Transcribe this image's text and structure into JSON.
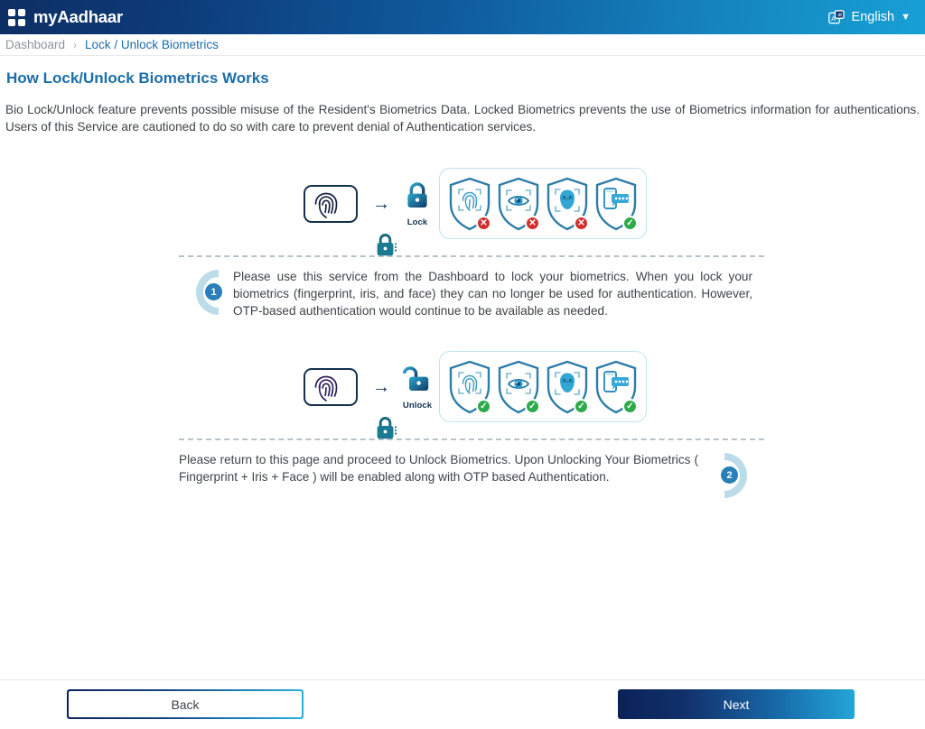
{
  "header": {
    "brand": "myAadhaar",
    "logo_icon": "grid-logo-icon",
    "language": "English",
    "language_icon": "translate-icon",
    "chevron": "⌄"
  },
  "breadcrumb": {
    "home": "Dashboard",
    "separator": "›",
    "current": "Lock / Unlock Biometrics"
  },
  "main": {
    "title": "How Lock/Unlock Biometrics Works",
    "intro": "Bio Lock/Unlock feature prevents possible misuse of the Resident's Biometrics Data. Locked Biometrics prevents the use of Biometrics information for authentications. Users of this Service are cautioned to do so with care to prevent denial of Authentication services."
  },
  "illustrations": [
    {
      "id": "lock-illustration",
      "lock_label": "Lock",
      "lock_state": "locked",
      "arrow": "→",
      "shields": [
        {
          "name": "fingerprint",
          "status": "disabled",
          "mark": "✕"
        },
        {
          "name": "iris",
          "status": "disabled",
          "mark": "✕"
        },
        {
          "name": "face",
          "status": "disabled",
          "mark": "✕"
        },
        {
          "name": "otp",
          "status": "enabled",
          "mark": "✓"
        }
      ]
    },
    {
      "id": "unlock-illustration",
      "lock_label": "Unlock",
      "lock_state": "unlocked",
      "arrow": "→",
      "shields": [
        {
          "name": "fingerprint",
          "status": "enabled",
          "mark": "✓"
        },
        {
          "name": "iris",
          "status": "enabled",
          "mark": "✓"
        },
        {
          "name": "face",
          "status": "enabled",
          "mark": "✓"
        },
        {
          "name": "otp",
          "status": "enabled",
          "mark": "✓"
        }
      ]
    }
  ],
  "steps": [
    {
      "number": "1",
      "text": "Please use this service from the Dashboard to lock your biometrics. When you lock  your biometrics (fingerprint, iris, and face)  they can no longer be used for authentication. However, OTP-based authentication would continue to be available as needed."
    },
    {
      "number": "2",
      "text": "Please return to this page and proceed to Unlock Biometrics. Upon Unlocking Your Biometrics ( Fingerprint + Iris + Face ) will be enabled along with OTP based Authentication."
    }
  ],
  "footer": {
    "back_label": "Back",
    "next_label": "Next"
  },
  "colors": {
    "header_start": "#0d2f63",
    "header_end": "#17a0d4",
    "title": "#1b6ea8",
    "link": "#1b6ea8",
    "muted": "#8d9499",
    "shield_outline": "#2e7ca8",
    "badge_error": "#d32f2f",
    "badge_ok": "#2eaa4a",
    "step_dot": "#2a7fb8"
  }
}
